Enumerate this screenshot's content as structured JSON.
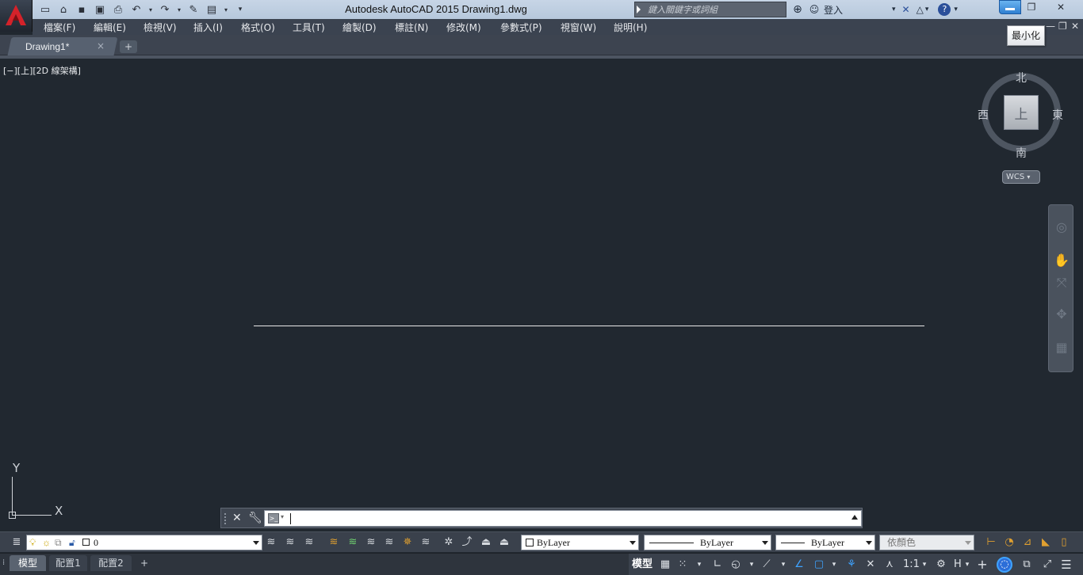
{
  "app": {
    "title": "Autodesk AutoCAD 2015    Drawing1.dwg",
    "app_letter": "A"
  },
  "search": {
    "placeholder": "鍵入關鍵字或詞組"
  },
  "account": {
    "signin": "登入"
  },
  "window": {
    "tooltip": "最小化"
  },
  "menu": {
    "items": [
      "檔案(F)",
      "編輯(E)",
      "檢視(V)",
      "插入(I)",
      "格式(O)",
      "工具(T)",
      "繪製(D)",
      "標註(N)",
      "修改(M)",
      "參數式(P)",
      "視窗(W)",
      "說明(H)"
    ]
  },
  "tabs": {
    "document": "Drawing1*",
    "close": "×",
    "add": "+"
  },
  "viewport": {
    "label": "[−][上][2D 線架構]"
  },
  "viewcube": {
    "face": "上",
    "north": "北",
    "south": "南",
    "east": "東",
    "west": "西",
    "wcs": "WCS"
  },
  "ucs": {
    "x": "X",
    "y": "Y"
  },
  "command": {
    "value": ""
  },
  "properties": {
    "layer": "0",
    "color": "ByLayer",
    "linetype": "ByLayer",
    "lineweight": "ByLayer",
    "plotstyle": "依顏色"
  },
  "status": {
    "layout_tabs": [
      "模型",
      "配置1",
      "配置2"
    ],
    "model_label": "模型",
    "scale": "1:1",
    "h_label": "H"
  },
  "colors": {
    "canvas": "#212830",
    "accent": "#3ea3ff",
    "titlebar": "#b6c8dc"
  }
}
